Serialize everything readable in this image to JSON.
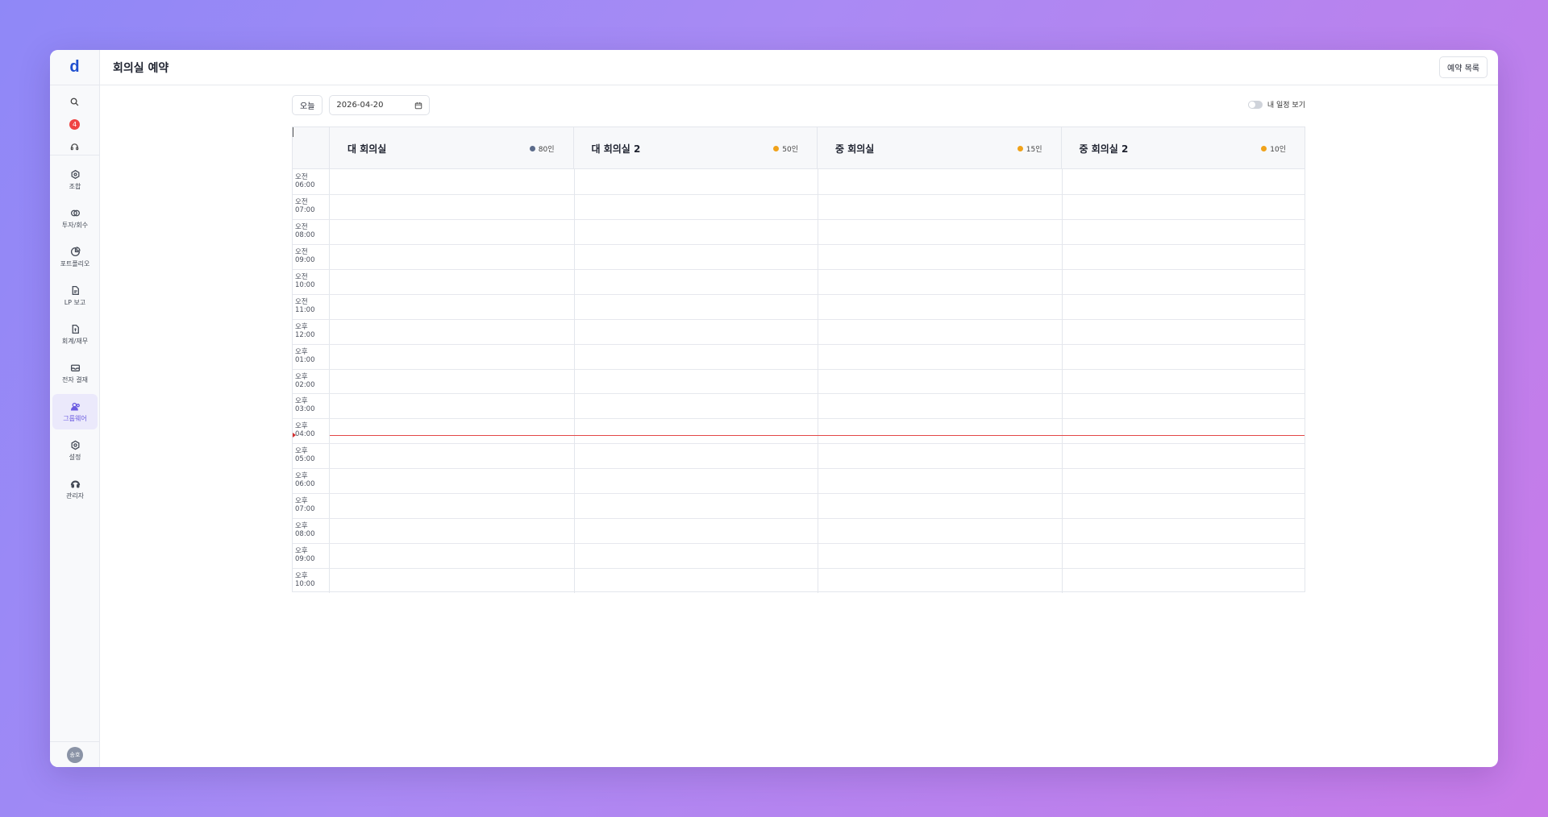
{
  "app": {
    "logo": "d",
    "title": "회의실 예약",
    "list_button": "예약 목록"
  },
  "sidebar": {
    "notification_count": "4",
    "items": [
      {
        "label": "조합",
        "icon": "union-icon"
      },
      {
        "label": "투자/회수",
        "icon": "investment-icon"
      },
      {
        "label": "포트폴리오",
        "icon": "portfolio-icon"
      },
      {
        "label": "LP 보고",
        "icon": "report-icon"
      },
      {
        "label": "회계/재무",
        "icon": "accounting-icon"
      },
      {
        "label": "전자 결재",
        "icon": "approval-icon"
      },
      {
        "label": "그룹웨어",
        "icon": "groupware-icon",
        "active": true
      },
      {
        "label": "설정",
        "icon": "settings-icon"
      },
      {
        "label": "관리자",
        "icon": "admin-icon"
      }
    ],
    "avatar": "송호"
  },
  "toolbar": {
    "today": "오늘",
    "date": "2026-04-20",
    "my_schedule": "내 일정 보기"
  },
  "rooms": [
    {
      "name": "대 회의실",
      "capacity": "80인",
      "color": "#5b6b8a"
    },
    {
      "name": "대 회의실 2",
      "capacity": "50인",
      "color": "#f0a21a"
    },
    {
      "name": "중 회의실",
      "capacity": "15인",
      "color": "#f0a21a"
    },
    {
      "name": "중 회의실 2",
      "capacity": "10인",
      "color": "#f0a21a"
    }
  ],
  "times": [
    "오전 06:00",
    "오전 07:00",
    "오전 08:00",
    "오전 09:00",
    "오전 10:00",
    "오전 11:00",
    "오후 12:00",
    "오후 01:00",
    "오후 02:00",
    "오후 03:00",
    "오후 04:00",
    "오후 05:00",
    "오후 06:00",
    "오후 07:00",
    "오후 08:00",
    "오후 09:00",
    "오후 10:00"
  ],
  "now_hour": 16.65,
  "colors": {
    "accent": "#6a5ae0",
    "now_line": "#e34848",
    "brand": "#1f4fcf"
  }
}
